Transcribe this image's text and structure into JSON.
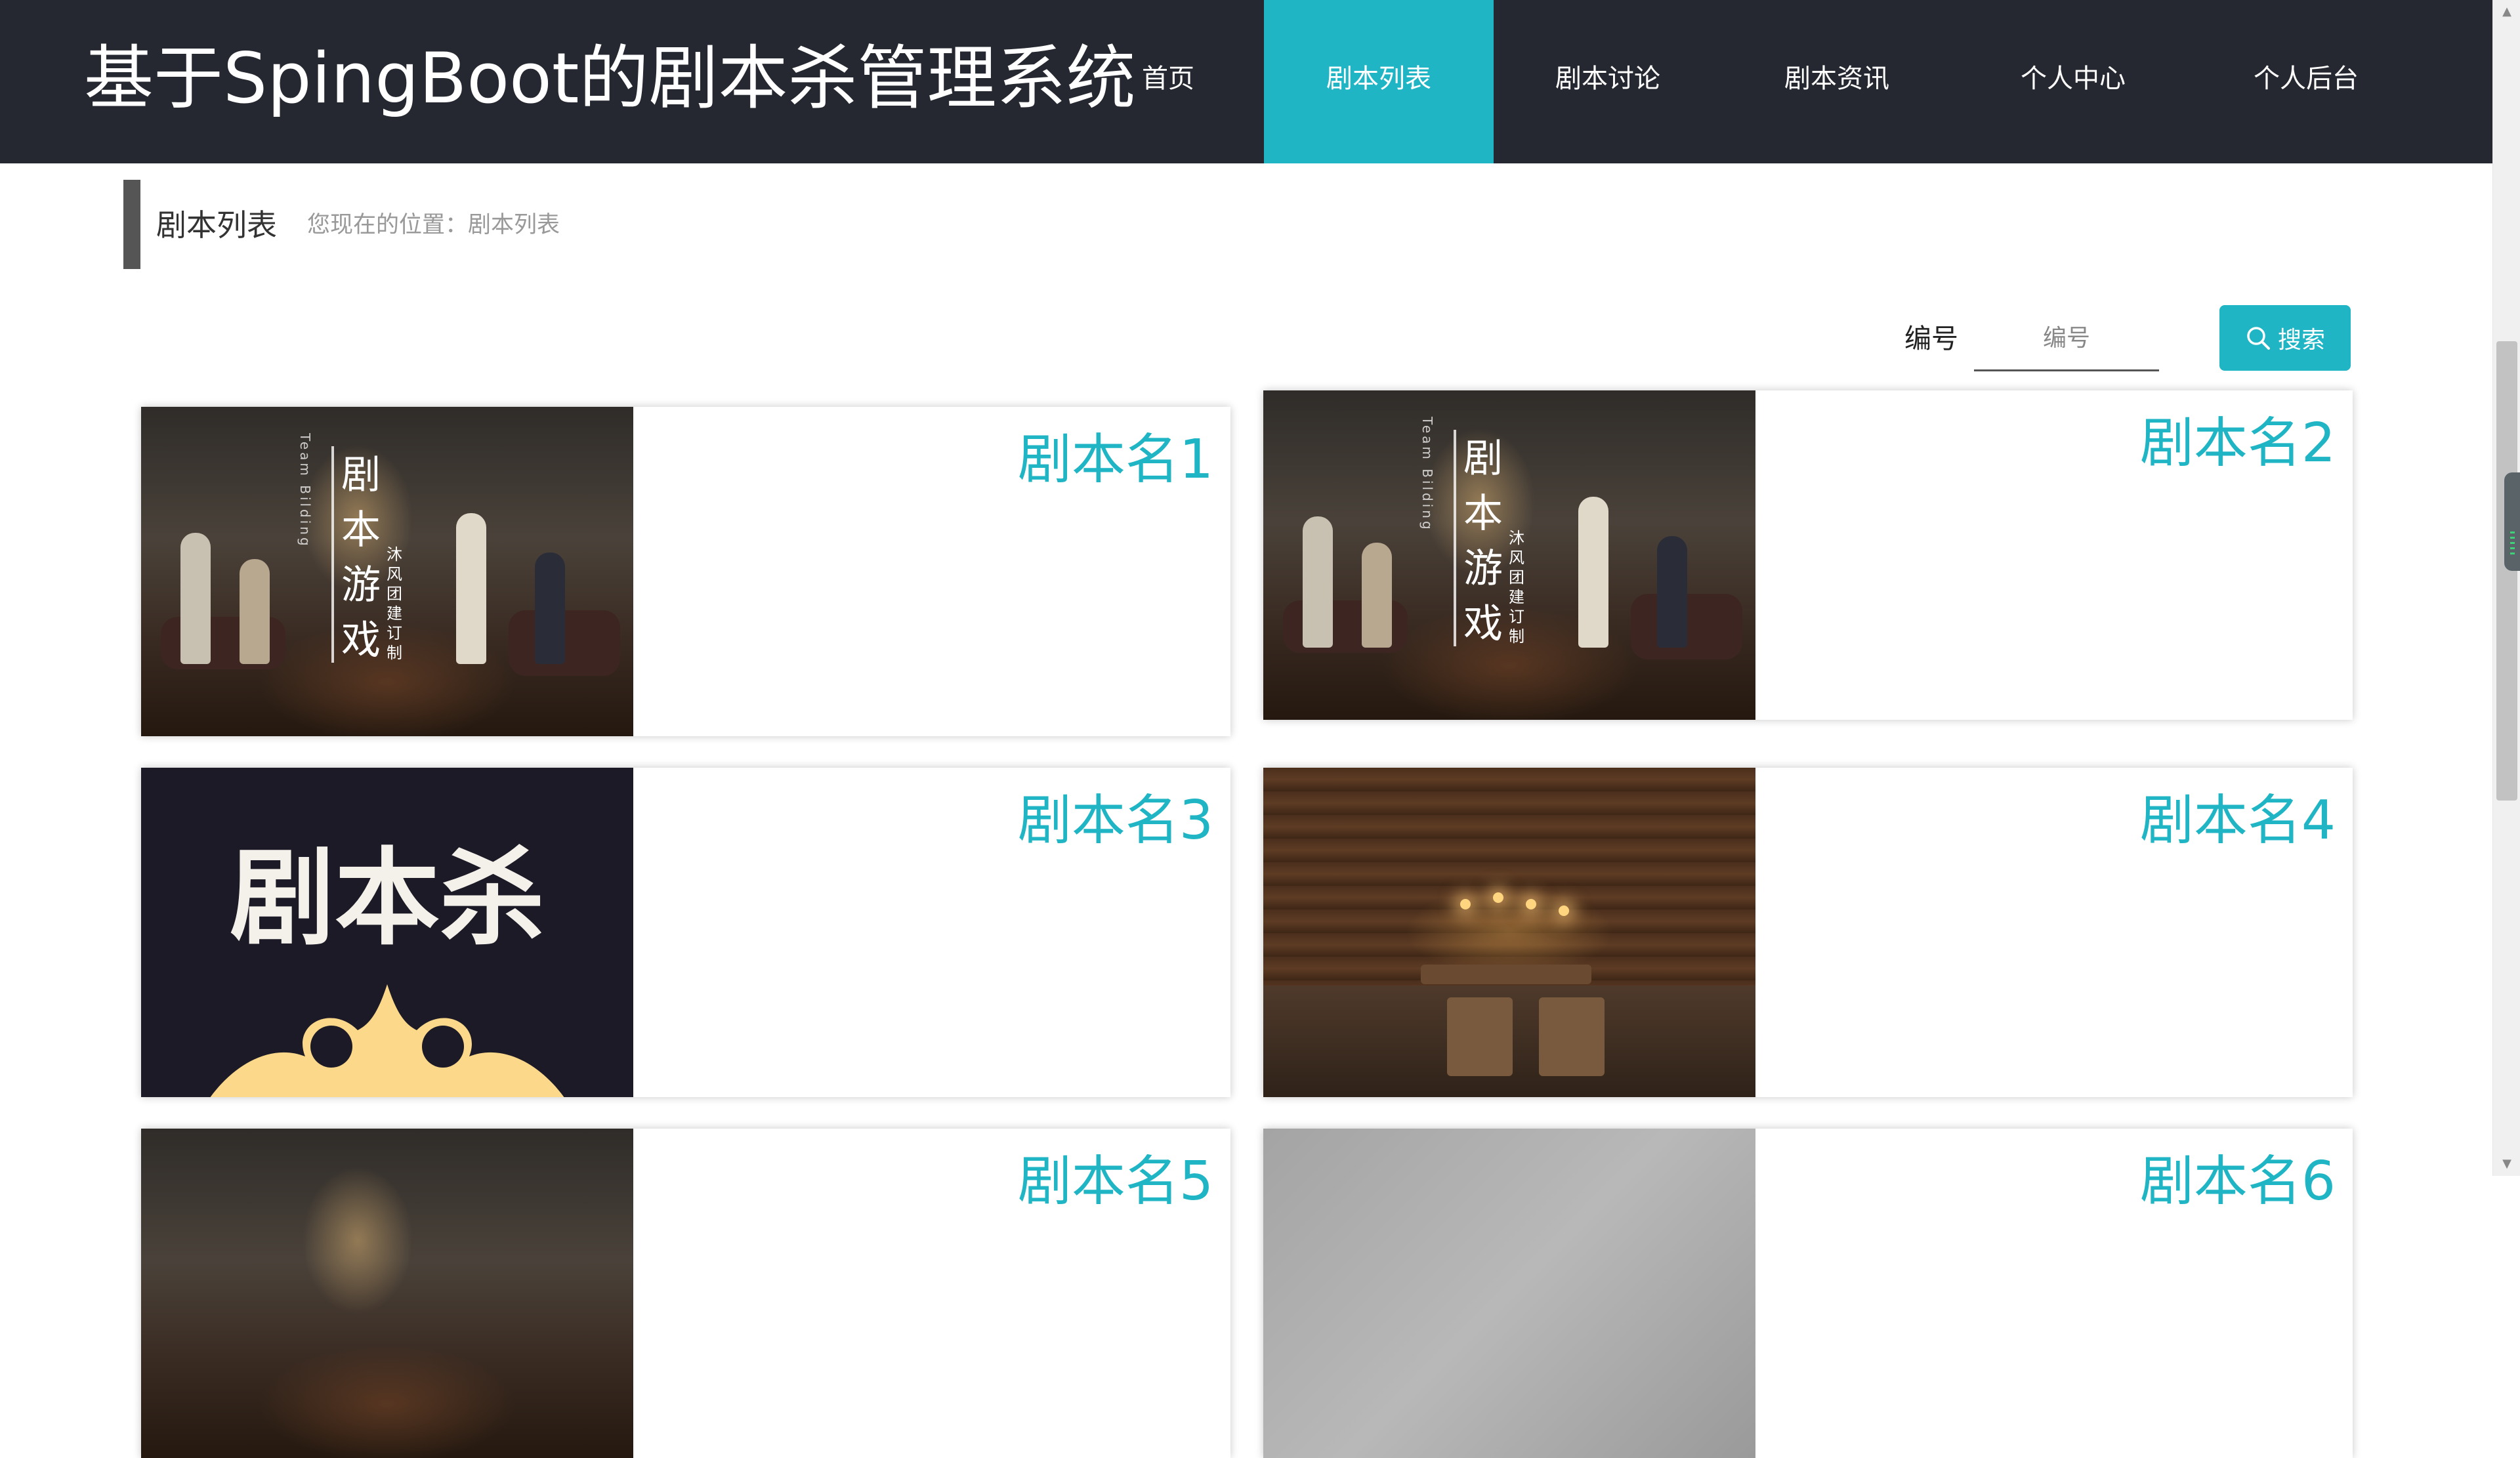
{
  "header": {
    "site_title": "基于SpingBoot的剧本杀管理系统",
    "nav": [
      {
        "label": "首页",
        "active": false
      },
      {
        "label": "剧本列表",
        "active": true
      },
      {
        "label": "剧本讨论",
        "active": false
      },
      {
        "label": "剧本资讯",
        "active": false
      },
      {
        "label": "个人中心",
        "active": false
      },
      {
        "label": "个人后台",
        "active": false
      }
    ]
  },
  "breadcrumb": {
    "title": "剧本列表",
    "location": "您现在的位置：剧本列表"
  },
  "search": {
    "label": "编号",
    "placeholder": "编号",
    "value": "",
    "button_label": "搜索"
  },
  "scripts": [
    {
      "title": "剧本名1",
      "image": "murder-mystery-room-poster"
    },
    {
      "title": "剧本名2",
      "image": "murder-mystery-room-poster"
    },
    {
      "title": "剧本名3",
      "image": "jubensha-logo-poster"
    },
    {
      "title": "剧本名4",
      "image": "tavern-interior-photo"
    },
    {
      "title": "剧本名5",
      "image": "murder-mystery-room-poster"
    },
    {
      "title": "剧本名6",
      "image": "floor-plan-model"
    }
  ],
  "poster": {
    "vertical_title": "剧本游戏",
    "vertical_subtitle": "沐风团建订制",
    "latin_text": "Team Bilding",
    "logo_text": "剧本杀"
  },
  "colors": {
    "header_bg": "#252830",
    "accent": "#1fb5c4",
    "breadcrumb_bar": "#555555",
    "poster_bg": "#1c1a26",
    "crown_gold": "#fcd88a"
  },
  "icons": {
    "search_button": "search-icon"
  }
}
